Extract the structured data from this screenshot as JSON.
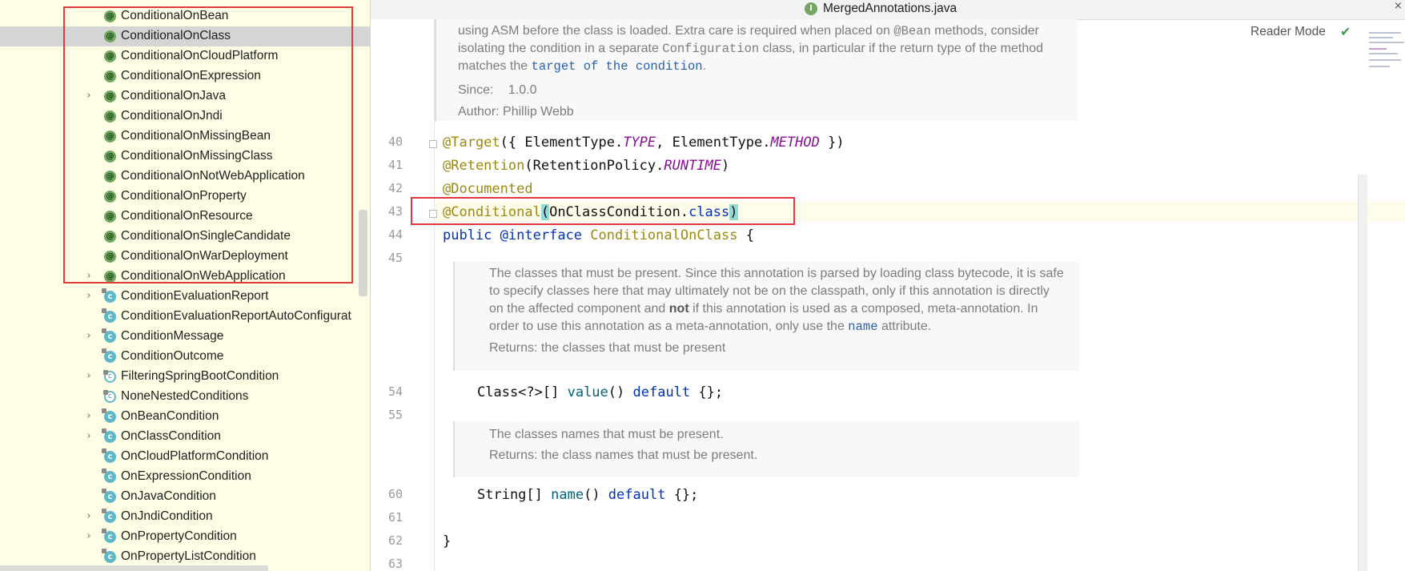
{
  "tree": {
    "items": [
      {
        "label": "ConditionalOnBean",
        "icon": "annotation-icon",
        "expandable": false,
        "selected": false
      },
      {
        "label": "ConditionalOnClass",
        "icon": "annotation-icon",
        "expandable": false,
        "selected": true
      },
      {
        "label": "ConditionalOnCloudPlatform",
        "icon": "annotation-icon",
        "expandable": false,
        "selected": false
      },
      {
        "label": "ConditionalOnExpression",
        "icon": "annotation-icon",
        "expandable": false,
        "selected": false
      },
      {
        "label": "ConditionalOnJava",
        "icon": "annotation-icon",
        "expandable": true,
        "selected": false
      },
      {
        "label": "ConditionalOnJndi",
        "icon": "annotation-icon",
        "expandable": false,
        "selected": false
      },
      {
        "label": "ConditionalOnMissingBean",
        "icon": "annotation-icon",
        "expandable": false,
        "selected": false
      },
      {
        "label": "ConditionalOnMissingClass",
        "icon": "annotation-icon",
        "expandable": false,
        "selected": false
      },
      {
        "label": "ConditionalOnNotWebApplication",
        "icon": "annotation-icon",
        "expandable": false,
        "selected": false
      },
      {
        "label": "ConditionalOnProperty",
        "icon": "annotation-icon",
        "expandable": false,
        "selected": false
      },
      {
        "label": "ConditionalOnResource",
        "icon": "annotation-icon",
        "expandable": false,
        "selected": false
      },
      {
        "label": "ConditionalOnSingleCandidate",
        "icon": "annotation-icon",
        "expandable": false,
        "selected": false
      },
      {
        "label": "ConditionalOnWarDeployment",
        "icon": "annotation-icon",
        "expandable": false,
        "selected": false
      },
      {
        "label": "ConditionalOnWebApplication",
        "icon": "annotation-icon",
        "expandable": true,
        "selected": false
      },
      {
        "label": "ConditionEvaluationReport",
        "icon": "class-icon",
        "expandable": true,
        "selected": false
      },
      {
        "label": "ConditionEvaluationReportAutoConfigurat",
        "icon": "class-icon",
        "expandable": false,
        "selected": false
      },
      {
        "label": "ConditionMessage",
        "icon": "class-icon",
        "expandable": true,
        "selected": false
      },
      {
        "label": "ConditionOutcome",
        "icon": "class-icon",
        "expandable": false,
        "selected": false
      },
      {
        "label": "FilteringSpringBootCondition",
        "icon": "abstract-class-icon",
        "expandable": true,
        "selected": false
      },
      {
        "label": "NoneNestedConditions",
        "icon": "abstract-class-icon",
        "expandable": false,
        "selected": false
      },
      {
        "label": "OnBeanCondition",
        "icon": "class-icon",
        "expandable": true,
        "selected": false
      },
      {
        "label": "OnClassCondition",
        "icon": "class-icon",
        "expandable": true,
        "selected": false
      },
      {
        "label": "OnCloudPlatformCondition",
        "icon": "class-icon",
        "expandable": false,
        "selected": false
      },
      {
        "label": "OnExpressionCondition",
        "icon": "class-icon",
        "expandable": false,
        "selected": false
      },
      {
        "label": "OnJavaCondition",
        "icon": "class-icon",
        "expandable": false,
        "selected": false
      },
      {
        "label": "OnJndiCondition",
        "icon": "class-icon",
        "expandable": true,
        "selected": false
      },
      {
        "label": "OnPropertyCondition",
        "icon": "class-icon",
        "expandable": true,
        "selected": false
      },
      {
        "label": "OnPropertyListCondition",
        "icon": "class-icon",
        "expandable": false,
        "selected": false
      }
    ]
  },
  "editor": {
    "tab_title": "MergedAnnotations.java",
    "tab_icon_letter": "I",
    "reader_mode": "Reader Mode",
    "top_doc": {
      "line1": [
        "using ASM before the class is loaded. Extra care is required when placed on ",
        "@Bean",
        " methods, consider"
      ],
      "line2": [
        "isolating the condition in a separate ",
        "Configuration",
        " class, in particular if the return type of the method"
      ],
      "line3": [
        "matches the ",
        "target of the condition",
        "."
      ],
      "since_label": "Since:",
      "since_value": "1.0.0",
      "author_label": "Author:",
      "author_value": "Phillip Webb"
    },
    "lines": {
      "n40": "40",
      "n41": "41",
      "n42": "42",
      "n43": "43",
      "n44": "44",
      "n45": "45",
      "n54": "54",
      "n55": "55",
      "n60": "60",
      "n61": "61",
      "n62": "62",
      "n63": "63"
    },
    "code": {
      "l40": [
        "@Target",
        "({ ElementType.",
        "TYPE",
        ", ElementType.",
        "METHOD",
        " })"
      ],
      "l41": [
        "@Retention",
        "(RetentionPolicy.",
        "RUNTIME",
        ")"
      ],
      "l42": [
        "@Documented"
      ],
      "l43": [
        "@Conditional",
        "(",
        "OnClassCondition.",
        "class",
        ")"
      ],
      "l44": [
        "public",
        " ",
        "@interface",
        " ",
        "ConditionalOnClass",
        " {"
      ],
      "l54": [
        "Class<?>[] ",
        "value",
        "() ",
        "default",
        " {};"
      ],
      "l60": [
        "String[] ",
        "name",
        "() ",
        "default",
        " {};"
      ],
      "l62": [
        "}"
      ]
    },
    "value_doc": {
      "line1": "The classes that must be present. Since this annotation is parsed by loading class bytecode, it is safe",
      "line2": "to specify classes here that may ultimately not be on the classpath, only if this annotation is directly",
      "line3": [
        "on the affected component and ",
        "not",
        " if this annotation is used as a composed, meta-annotation. In"
      ],
      "line4": [
        "order to use this annotation as a meta-annotation, only use the ",
        "name",
        " attribute."
      ],
      "returns_label": "Returns:",
      "returns_value": "the classes that must be present"
    },
    "name_doc": {
      "line1": "The classes names that must be present.",
      "returns_label": "Returns:",
      "returns_value": "the class names that must be present."
    }
  }
}
